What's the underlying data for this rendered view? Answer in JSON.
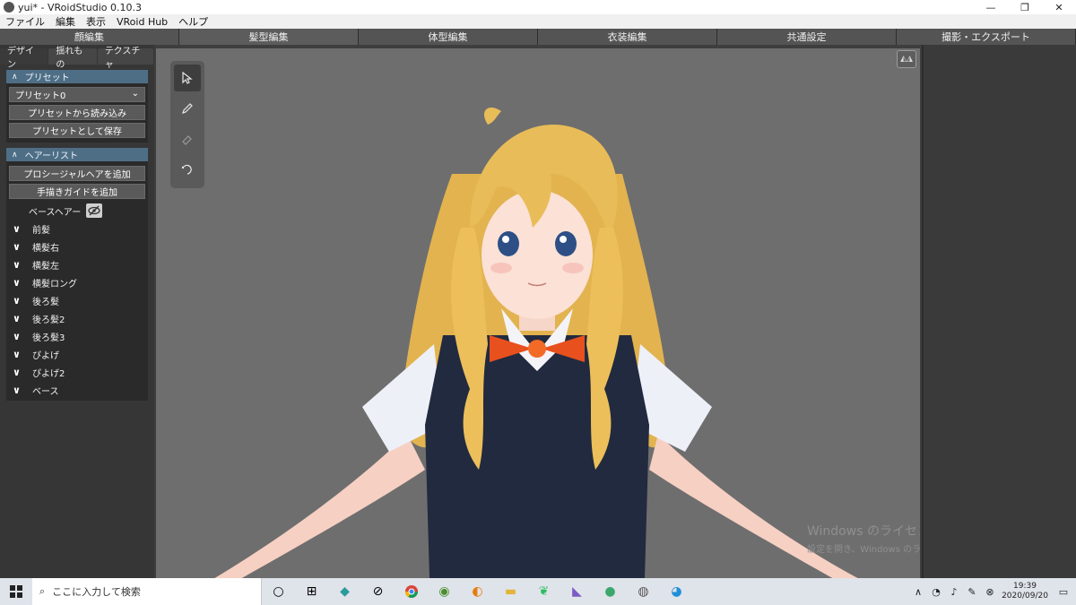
{
  "window": {
    "title": "yui* - VRoidStudio 0.10.3"
  },
  "menu": [
    "ファイル",
    "編集",
    "表示",
    "VRoid Hub",
    "ヘルプ"
  ],
  "main_tabs": [
    "顔編集",
    "髪型編集",
    "体型編集",
    "衣装編集",
    "共通設定",
    "撮影・エクスポート"
  ],
  "sub_tabs": [
    "デザイン",
    "揺れもの",
    "テクスチャ"
  ],
  "preset_section": {
    "header": "プリセット",
    "selected": "プリセット0",
    "load_button": "プリセットから読み込み",
    "save_button": "プリセットとして保存"
  },
  "hair_section": {
    "header": "ヘアーリスト",
    "add_procedural_button": "プロシージャルヘアを追加",
    "add_guide_button": "手描きガイドを追加",
    "base_hair": "ベースヘアー",
    "items": [
      "前髪",
      "横髪右",
      "横髪左",
      "横髪ロング",
      "後ろ髪",
      "後ろ髪2",
      "後ろ髪3",
      "ぴよげ",
      "ぴよげ2",
      "ベース"
    ]
  },
  "watermark": {
    "line1": "Windows のライセンス認証",
    "line2": "設定を開き、Windows のライセンス認証を行ってください。"
  },
  "taskbar": {
    "search_placeholder": "ここに入力して検索",
    "time": "19:39",
    "date": "2020/09/20"
  }
}
